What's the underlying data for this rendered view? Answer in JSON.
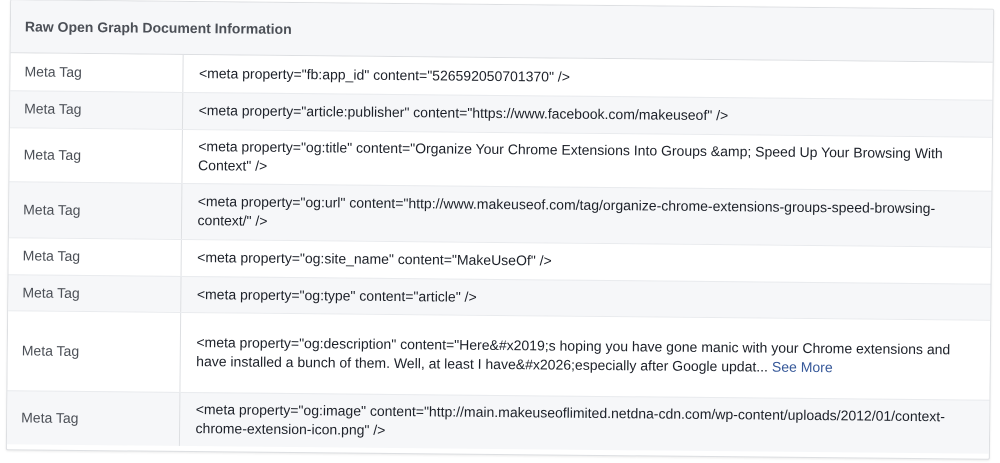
{
  "panel": {
    "title": "Raw Open Graph Document Information"
  },
  "rows": [
    {
      "label": "Meta Tag",
      "value": "<meta property=\"fb:app_id\" content=\"526592050701370\" />"
    },
    {
      "label": "Meta Tag",
      "value": "<meta property=\"article:publisher\" content=\"https://www.facebook.com/makeuseof\" />"
    },
    {
      "label": "Meta Tag",
      "value": "<meta property=\"og:title\" content=\"Organize Your Chrome Extensions Into Groups &amp; Speed Up Your Browsing With Context\" />"
    },
    {
      "label": "Meta Tag",
      "value": "<meta property=\"og:url\" content=\"http://www.makeuseof.com/tag/organize-chrome-extensions-groups-speed-browsing-context/\" />"
    },
    {
      "label": "Meta Tag",
      "value": "<meta property=\"og:site_name\" content=\"MakeUseOf\" />"
    },
    {
      "label": "Meta Tag",
      "value": "<meta property=\"og:type\" content=\"article\" />"
    },
    {
      "label": "Meta Tag",
      "value": "<meta property=\"og:description\" content=\"Here&#x2019;s hoping you have gone manic with your Chrome extensions and have installed a bunch of them. Well, at least I have&#x2026;especially after Google updat...",
      "see_more": "See More"
    },
    {
      "label": "Meta Tag",
      "value": "<meta property=\"og:image\" content=\"http://main.makeuseoflimited.netdna-cdn.com/wp-content/uploads/2012/01/context-chrome-extension-icon.png\" />"
    }
  ],
  "colors": {
    "header_bg": "#f6f7f9",
    "border": "#dddfe2",
    "link": "#365899"
  }
}
